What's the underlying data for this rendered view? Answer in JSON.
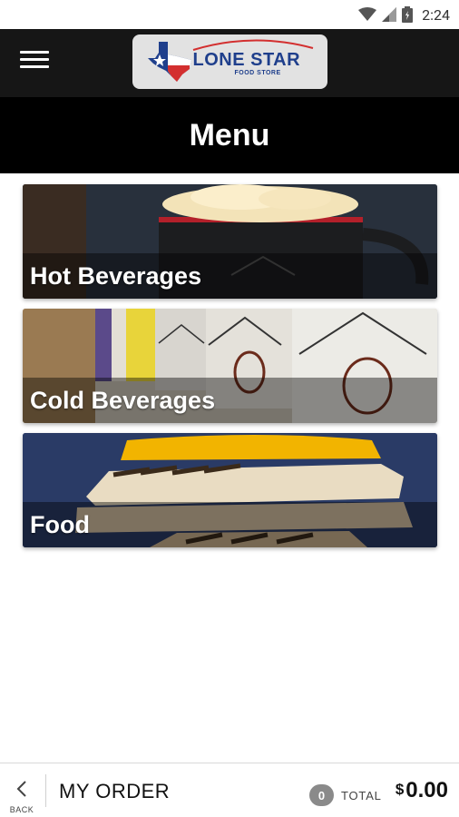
{
  "status_bar": {
    "time": "2:24"
  },
  "app_bar": {
    "logo": {
      "title": "LONE STAR",
      "subtitle": "FOOD STORE"
    }
  },
  "page": {
    "title": "Menu"
  },
  "categories": [
    {
      "label": "Hot Beverages"
    },
    {
      "label": "Cold Beverages"
    },
    {
      "label": "Food"
    }
  ],
  "bottom_bar": {
    "back_label": "BACK",
    "my_order_label": "MY ORDER",
    "item_count": "0",
    "total_label": "TOTAL",
    "currency": "$",
    "total_amount": "0.00"
  },
  "colors": {
    "app_bar_bg": "#161616",
    "title_band_bg": "#000000",
    "logo_blue": "#1f3f8c",
    "logo_red": "#d32f2f",
    "badge_gray": "#8a8a8a"
  }
}
